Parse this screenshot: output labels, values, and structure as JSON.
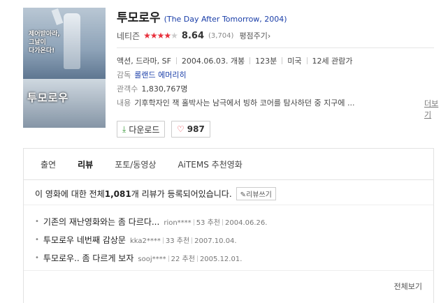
{
  "movie": {
    "title": "투모로우",
    "original": "(The Day After Tomorrow, 2004)",
    "rating_label": "네티즌",
    "stars_full": "★★★★",
    "stars_empty": "★",
    "score": "8.64",
    "count": "(3,704)",
    "rate_link": "평점주기",
    "genre": "액션, 드라마, SF",
    "release": "2004.06.03. 개봉",
    "runtime": "123분",
    "country": "미국",
    "age": "12세 관람가",
    "director_label": "감독",
    "director": "롤랜드 에머리히",
    "audience_label": "관객수",
    "audience": "1,830,767명",
    "plot_label": "내용",
    "plot": "기후학자인 잭 홀박사는 남극에서 빙하 코어를 탐사하던 중 지구에 ...",
    "more": "더보기"
  },
  "poster": {
    "tagline": "제어받아라,\n그날이\n다가온다!",
    "title": "투모로우"
  },
  "buttons": {
    "download": "다운로드",
    "like_count": "987"
  },
  "tabs": [
    "출연",
    "리뷰",
    "포토/동영상",
    "AiTEMS 추천영화"
  ],
  "review_summary": {
    "prefix": "이 영화에 대한 전체 ",
    "count": "1,081",
    "suffix": "개 리뷰가 등록되어있습니다.",
    "write": "리뷰쓰기"
  },
  "reviews": [
    {
      "title": "기존의 재난영화와는 좀 다르다...",
      "user": "rion****",
      "recs": "53 추천",
      "date": "2004.06.26."
    },
    {
      "title": "투모로우 네번째 감상문",
      "user": "kka2****",
      "recs": "33 추천",
      "date": "2007.10.04."
    },
    {
      "title": "투모로우.. 좀 다르게 보자",
      "user": "sooj****",
      "recs": "22 추천",
      "date": "2005.12.01."
    }
  ],
  "view_all": "전체보기"
}
